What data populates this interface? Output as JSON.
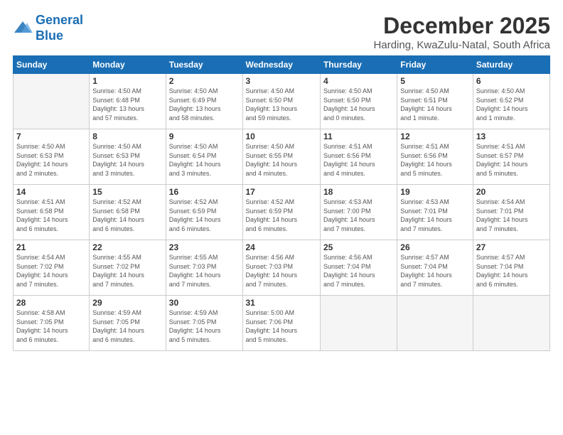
{
  "logo": {
    "line1": "General",
    "line2": "Blue"
  },
  "title": "December 2025",
  "subtitle": "Harding, KwaZulu-Natal, South Africa",
  "headers": [
    "Sunday",
    "Monday",
    "Tuesday",
    "Wednesday",
    "Thursday",
    "Friday",
    "Saturday"
  ],
  "weeks": [
    [
      {
        "day": "",
        "info": ""
      },
      {
        "day": "1",
        "info": "Sunrise: 4:50 AM\nSunset: 6:48 PM\nDaylight: 13 hours\nand 57 minutes."
      },
      {
        "day": "2",
        "info": "Sunrise: 4:50 AM\nSunset: 6:49 PM\nDaylight: 13 hours\nand 58 minutes."
      },
      {
        "day": "3",
        "info": "Sunrise: 4:50 AM\nSunset: 6:50 PM\nDaylight: 13 hours\nand 59 minutes."
      },
      {
        "day": "4",
        "info": "Sunrise: 4:50 AM\nSunset: 6:50 PM\nDaylight: 14 hours\nand 0 minutes."
      },
      {
        "day": "5",
        "info": "Sunrise: 4:50 AM\nSunset: 6:51 PM\nDaylight: 14 hours\nand 1 minute."
      },
      {
        "day": "6",
        "info": "Sunrise: 4:50 AM\nSunset: 6:52 PM\nDaylight: 14 hours\nand 1 minute."
      }
    ],
    [
      {
        "day": "7",
        "info": "Sunrise: 4:50 AM\nSunset: 6:53 PM\nDaylight: 14 hours\nand 2 minutes."
      },
      {
        "day": "8",
        "info": "Sunrise: 4:50 AM\nSunset: 6:53 PM\nDaylight: 14 hours\nand 3 minutes."
      },
      {
        "day": "9",
        "info": "Sunrise: 4:50 AM\nSunset: 6:54 PM\nDaylight: 14 hours\nand 3 minutes."
      },
      {
        "day": "10",
        "info": "Sunrise: 4:50 AM\nSunset: 6:55 PM\nDaylight: 14 hours\nand 4 minutes."
      },
      {
        "day": "11",
        "info": "Sunrise: 4:51 AM\nSunset: 6:56 PM\nDaylight: 14 hours\nand 4 minutes."
      },
      {
        "day": "12",
        "info": "Sunrise: 4:51 AM\nSunset: 6:56 PM\nDaylight: 14 hours\nand 5 minutes."
      },
      {
        "day": "13",
        "info": "Sunrise: 4:51 AM\nSunset: 6:57 PM\nDaylight: 14 hours\nand 5 minutes."
      }
    ],
    [
      {
        "day": "14",
        "info": "Sunrise: 4:51 AM\nSunset: 6:58 PM\nDaylight: 14 hours\nand 6 minutes."
      },
      {
        "day": "15",
        "info": "Sunrise: 4:52 AM\nSunset: 6:58 PM\nDaylight: 14 hours\nand 6 minutes."
      },
      {
        "day": "16",
        "info": "Sunrise: 4:52 AM\nSunset: 6:59 PM\nDaylight: 14 hours\nand 6 minutes."
      },
      {
        "day": "17",
        "info": "Sunrise: 4:52 AM\nSunset: 6:59 PM\nDaylight: 14 hours\nand 6 minutes."
      },
      {
        "day": "18",
        "info": "Sunrise: 4:53 AM\nSunset: 7:00 PM\nDaylight: 14 hours\nand 7 minutes."
      },
      {
        "day": "19",
        "info": "Sunrise: 4:53 AM\nSunset: 7:01 PM\nDaylight: 14 hours\nand 7 minutes."
      },
      {
        "day": "20",
        "info": "Sunrise: 4:54 AM\nSunset: 7:01 PM\nDaylight: 14 hours\nand 7 minutes."
      }
    ],
    [
      {
        "day": "21",
        "info": "Sunrise: 4:54 AM\nSunset: 7:02 PM\nDaylight: 14 hours\nand 7 minutes."
      },
      {
        "day": "22",
        "info": "Sunrise: 4:55 AM\nSunset: 7:02 PM\nDaylight: 14 hours\nand 7 minutes."
      },
      {
        "day": "23",
        "info": "Sunrise: 4:55 AM\nSunset: 7:03 PM\nDaylight: 14 hours\nand 7 minutes."
      },
      {
        "day": "24",
        "info": "Sunrise: 4:56 AM\nSunset: 7:03 PM\nDaylight: 14 hours\nand 7 minutes."
      },
      {
        "day": "25",
        "info": "Sunrise: 4:56 AM\nSunset: 7:04 PM\nDaylight: 14 hours\nand 7 minutes."
      },
      {
        "day": "26",
        "info": "Sunrise: 4:57 AM\nSunset: 7:04 PM\nDaylight: 14 hours\nand 7 minutes."
      },
      {
        "day": "27",
        "info": "Sunrise: 4:57 AM\nSunset: 7:04 PM\nDaylight: 14 hours\nand 6 minutes."
      }
    ],
    [
      {
        "day": "28",
        "info": "Sunrise: 4:58 AM\nSunset: 7:05 PM\nDaylight: 14 hours\nand 6 minutes."
      },
      {
        "day": "29",
        "info": "Sunrise: 4:59 AM\nSunset: 7:05 PM\nDaylight: 14 hours\nand 6 minutes."
      },
      {
        "day": "30",
        "info": "Sunrise: 4:59 AM\nSunset: 7:05 PM\nDaylight: 14 hours\nand 5 minutes."
      },
      {
        "day": "31",
        "info": "Sunrise: 5:00 AM\nSunset: 7:06 PM\nDaylight: 14 hours\nand 5 minutes."
      },
      {
        "day": "",
        "info": ""
      },
      {
        "day": "",
        "info": ""
      },
      {
        "day": "",
        "info": ""
      }
    ]
  ]
}
